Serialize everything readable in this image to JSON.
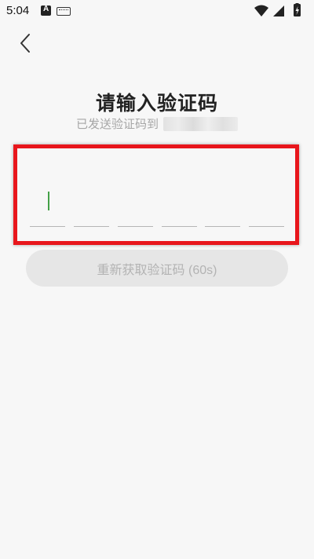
{
  "status_bar": {
    "time": "5:04",
    "icons": [
      "a-app-icon",
      "keyboard-icon",
      "wifi-icon",
      "signal-icon",
      "battery-charging-icon"
    ]
  },
  "header": {
    "back_icon": "chevron-left-icon"
  },
  "main": {
    "title": "请输入验证码",
    "subtitle": "已发送验证码到",
    "code_slots": [
      "",
      "",
      "",
      "",
      "",
      ""
    ],
    "resend_label": "重新获取验证码 (60s)"
  },
  "colors": {
    "highlight_border": "#e8161c",
    "cursor": "#43a047",
    "button_bg": "#e6e6e6",
    "button_text": "#b3b3b3"
  }
}
